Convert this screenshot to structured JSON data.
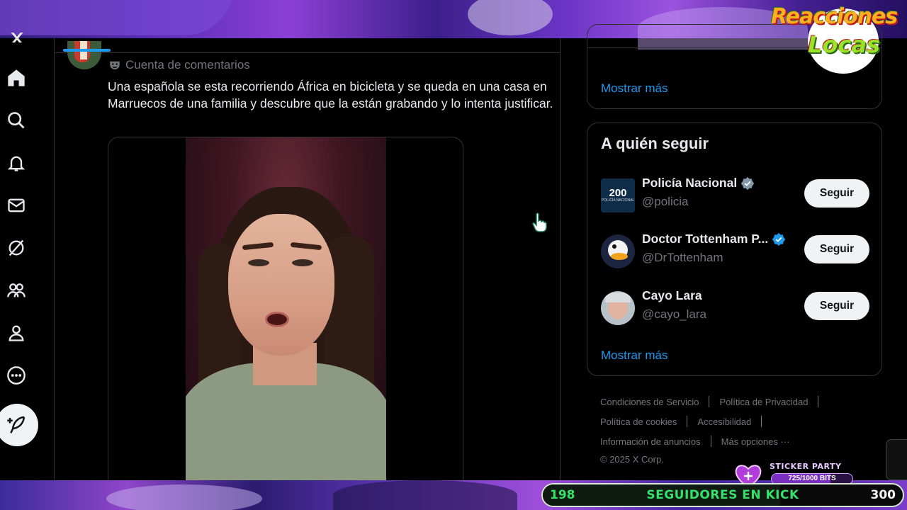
{
  "overlay": {
    "logo_line1": "Reacciones",
    "logo_line2": "Locas",
    "sticker_label": "STICKER PARTY",
    "bits_text": "725/1000 BITS",
    "bits_progress": 0.725,
    "followers_current": "198",
    "followers_title": "SEGUIDORES EN KICK",
    "followers_goal": "300",
    "followers_progress": 0.66
  },
  "nav": {
    "items": [
      {
        "name": "home",
        "icon": "home-icon"
      },
      {
        "name": "explore",
        "icon": "search-icon"
      },
      {
        "name": "notifications",
        "icon": "bell-icon"
      },
      {
        "name": "messages",
        "icon": "mail-icon"
      },
      {
        "name": "grok",
        "icon": "grok-icon"
      },
      {
        "name": "communities",
        "icon": "people-icon"
      },
      {
        "name": "profile",
        "icon": "person-icon"
      },
      {
        "name": "more",
        "icon": "more-circle-icon"
      }
    ],
    "post_icon": "feather-plus-icon"
  },
  "tweet": {
    "community": "Cuenta de comentarios",
    "text": "Una española se esta recorriendo África en bicicleta y se queda en una casa en Marruecos de una familia y descubre que la están grabando y lo intenta justificar."
  },
  "sidebar": {
    "top_show_more": "Mostrar más",
    "who_to_follow": {
      "title": "A quién seguir",
      "accounts": [
        {
          "name": "Policía Nacional",
          "handle": "@policia",
          "button": "Seguir",
          "verified_color": "#829aab",
          "avatar_text": "200",
          "avatar_sub": "POLICÍA NACIONAL"
        },
        {
          "name": "Doctor Tottenham P...",
          "handle": "@DrTottenham",
          "button": "Seguir",
          "verified_color": "#1d9bf0"
        },
        {
          "name": "Cayo Lara",
          "handle": "@cayo_lara",
          "button": "Seguir"
        }
      ],
      "show_more": "Mostrar más"
    },
    "footer": {
      "terms": "Condiciones de Servicio",
      "privacy": "Política de Privacidad",
      "cookies": "Política de cookies",
      "accessibility": "Accesibilidad",
      "ads_info": "Información de anuncios",
      "more_options": "Más opciones ···",
      "copyright": "© 2025 X Corp."
    }
  },
  "colors": {
    "accent": "#1d9bf0",
    "border": "#2f3336",
    "muted": "#71767b",
    "text": "#e7e9ea"
  }
}
